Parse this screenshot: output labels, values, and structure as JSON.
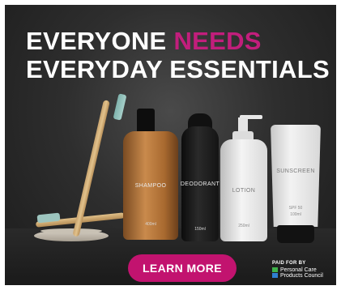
{
  "ad": {
    "headline_line1_prefix": "EVERYONE",
    "headline_line1_highlight": "NEEDS",
    "headline_line2": "EVERYDAY ESSENTIALS",
    "cta_label": "LEARN MORE",
    "paid_for_by": "PAID FOR BY",
    "sponsor_line1": "Personal Care",
    "sponsor_line2": "Products Council"
  },
  "products": {
    "shampoo": {
      "label": "SHAMPOO",
      "size": "400ml"
    },
    "deodorant": {
      "label": "DEODORANT",
      "size": "150ml"
    },
    "lotion": {
      "label": "LOTION",
      "size": "250ml"
    },
    "sunscreen": {
      "label": "SUNSCREEN",
      "spf": "SPF 50",
      "size": "100ml"
    }
  },
  "colors": {
    "accent_pink": "#c21e7c",
    "background": "#2e2e2e",
    "logo_green": "#3fb24a",
    "logo_blue": "#2f7fd1"
  }
}
